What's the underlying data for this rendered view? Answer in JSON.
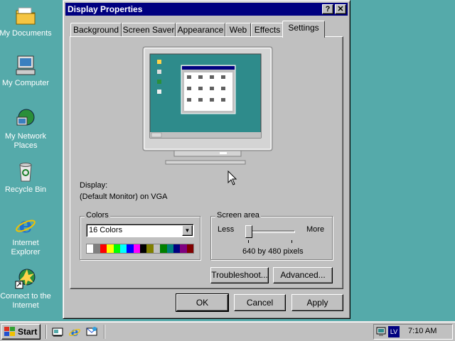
{
  "desktop": {
    "icons": [
      {
        "label": "My Documents",
        "icon": "folder-icon"
      },
      {
        "label": "My Computer",
        "icon": "computer-icon"
      },
      {
        "label": "My Network Places",
        "icon": "network-icon"
      },
      {
        "label": "Recycle Bin",
        "icon": "recycle-bin-icon"
      },
      {
        "label": "Internet Explorer",
        "icon": "internet-explorer-icon"
      },
      {
        "label": "Connect to the Internet",
        "icon": "connect-internet-icon"
      }
    ]
  },
  "window": {
    "title": "Display Properties",
    "help_btn": "?",
    "close_btn": "✕",
    "tabs": [
      {
        "label": "Background"
      },
      {
        "label": "Screen Saver"
      },
      {
        "label": "Appearance"
      },
      {
        "label": "Web"
      },
      {
        "label": "Effects"
      },
      {
        "label": "Settings",
        "active": true
      }
    ],
    "settings": {
      "display_label": "Display:",
      "display_value": "(Default Monitor) on VGA",
      "colors_group": "Colors",
      "colors_selected": "16 Colors",
      "palette": [
        "#ffffff",
        "#808080",
        "#ff0000",
        "#ffff00",
        "#00ff00",
        "#00ffff",
        "#0000ff",
        "#ff00ff",
        "#000000",
        "#808000",
        "#c0c0c0",
        "#008000",
        "#008080",
        "#000080",
        "#800080",
        "#800000"
      ],
      "screen_area_group": "Screen area",
      "less_label": "Less",
      "more_label": "More",
      "resolution": "640 by 480 pixels",
      "troubleshoot_btn": "Troubleshoot...",
      "advanced_btn": "Advanced..."
    },
    "buttons": {
      "ok": "OK",
      "cancel": "Cancel",
      "apply": "Apply"
    }
  },
  "taskbar": {
    "start_label": "Start",
    "quick_launch": [
      "show-desktop-icon",
      "internet-explorer-icon",
      "outlook-icon"
    ],
    "tray": {
      "lang": "LV",
      "time": "7:10 AM"
    }
  },
  "colors": {
    "desktop": "#55aaaa",
    "titlebar": "#000080",
    "face": "#c0c0c0"
  }
}
